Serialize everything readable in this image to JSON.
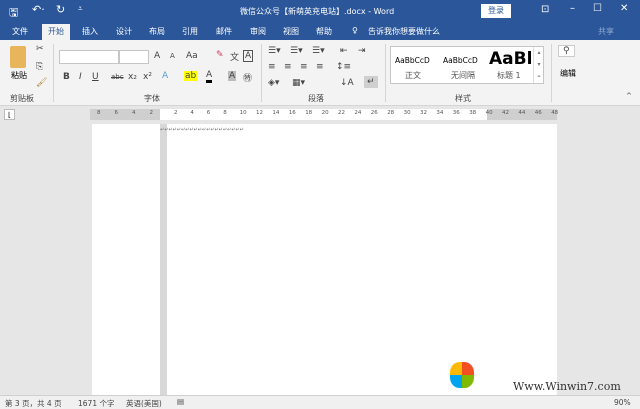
{
  "title": "微信公众号【新萌英充电站】.docx - Word",
  "login": "登录",
  "tabs": [
    "文件",
    "开始",
    "插入",
    "设计",
    "布局",
    "引用",
    "邮件",
    "审阅",
    "视图",
    "帮助"
  ],
  "tell_me": "告诉我你想要做什么",
  "share": "共享",
  "clipboard": {
    "paste": "粘贴",
    "label": "剪贴板"
  },
  "font": {
    "label": "字体",
    "grow": "A",
    "shrink": "A",
    "case": "Aa",
    "bold": "B",
    "italic": "I",
    "underline": "U",
    "strike": "abc",
    "sub": "x₂",
    "sup": "x²"
  },
  "paragraph": {
    "label": "段落"
  },
  "styles": {
    "label": "样式",
    "items": [
      {
        "preview": "AaBbCcD",
        "name": "正文"
      },
      {
        "preview": "AaBbCcD",
        "name": "无间隔"
      },
      {
        "preview": "AaBl",
        "name": "标题 1"
      }
    ]
  },
  "editing": {
    "label": "编辑"
  },
  "ruler": {
    "left": [
      "8",
      "6",
      "4",
      "2"
    ],
    "right": [
      "2",
      "4",
      "6",
      "8",
      "10",
      "12",
      "14",
      "16",
      "18",
      "20",
      "22",
      "24",
      "26",
      "28",
      "30",
      "32",
      "34",
      "36",
      "38",
      "40",
      "42",
      "44",
      "46",
      "48"
    ]
  },
  "status": {
    "page": "第 3 页，共 4 页",
    "words": "1671 个字",
    "lang": "英语(美国)",
    "zoom": "90%"
  },
  "watermark": "Www.Winwin7.com"
}
